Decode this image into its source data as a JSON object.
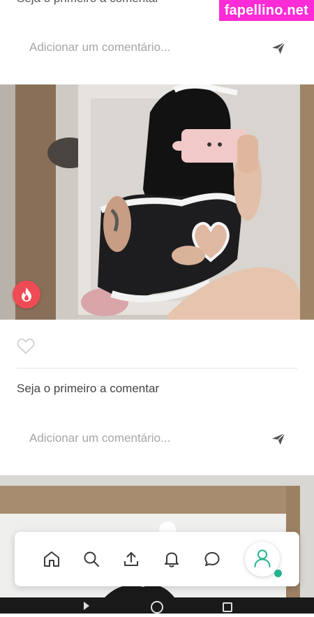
{
  "watermark": "fapellino.net",
  "top_partial_text": "Seja o primeiro a comentar",
  "comment_placeholder_top": "Adicionar um comentário...",
  "post": {
    "first_comment_text": "Seja o primeiro a comentar",
    "comment_placeholder": "Adicionar um comentário..."
  },
  "icons": {
    "send": "send-icon",
    "fire": "fire-icon",
    "like": "heart-icon",
    "nav": [
      "home-icon",
      "search-icon",
      "upload-icon",
      "bell-icon",
      "chat-icon",
      "profile-icon"
    ]
  },
  "colors": {
    "accent": "#24b38f",
    "fire_badge": "#ef4b55",
    "watermark_bg": "#ff2bd6"
  }
}
